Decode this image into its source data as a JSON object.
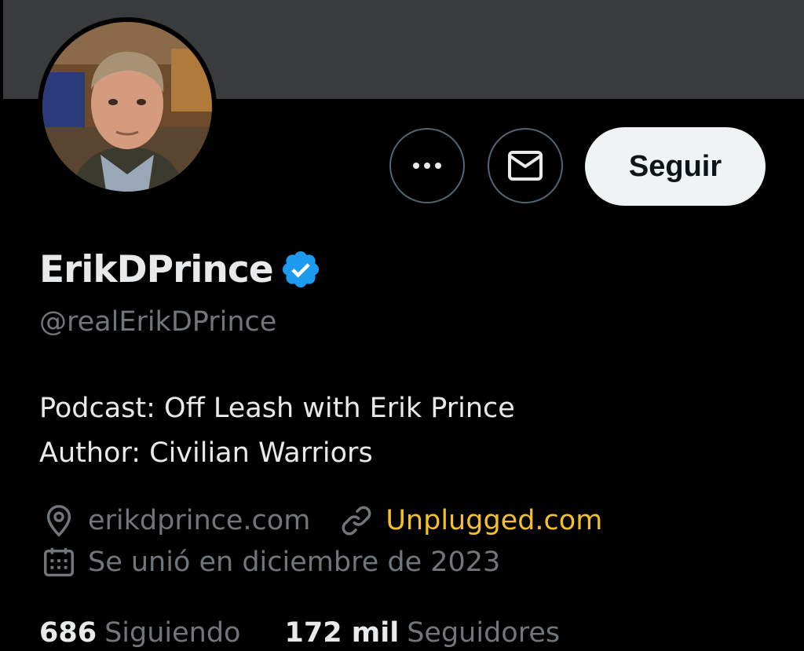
{
  "profile": {
    "display_name": "ErikDPrince",
    "handle": "@realErikDPrince",
    "verified_icon": "verified-badge-icon",
    "verified_color": "#1d9bf0",
    "bio_lines": [
      "Podcast: Off Leash with Erik Prince",
      "Author: Civilian Warriors"
    ],
    "website_1": "erikdprince.com",
    "website_2": "Unplugged.com",
    "website_2_color": "#f4c02a",
    "joined": "Se unió en diciembre de 2023"
  },
  "actions": {
    "more_icon": "more-icon",
    "message_icon": "envelope-icon",
    "follow_label": "Seguir"
  },
  "stats": {
    "following_count": "686",
    "following_label": "Siguiendo",
    "followers_count": "172 mil",
    "followers_label": "Seguidores"
  },
  "colors": {
    "background": "#000000",
    "banner": "#3a3b3d",
    "text_primary": "#e7e9ea",
    "text_secondary": "#71767b",
    "button_border": "#536471"
  }
}
